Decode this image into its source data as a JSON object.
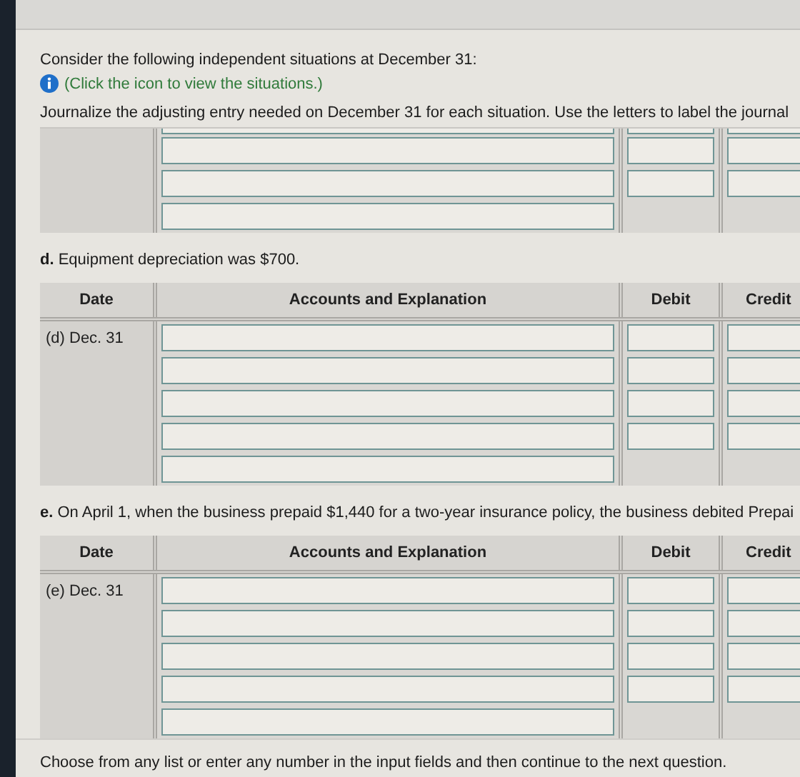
{
  "intro": {
    "heading": "Consider the following independent situations at December 31:",
    "info_link": "(Click the icon to view the situations.)",
    "instruction": "Journalize the adjusting entry needed on December 31 for each situation. Use the letters to label the journal"
  },
  "partial_table": {
    "rows": [
      {
        "amounts": true,
        "cut": true
      },
      {
        "amounts": true,
        "cut": false
      },
      {
        "amounts": true,
        "cut": false
      },
      {
        "amounts": false,
        "cut": false
      }
    ]
  },
  "entries": [
    {
      "prompt": "**d.** Equipment depreciation was $700.",
      "columns": [
        "Date",
        "Accounts and Explanation",
        "Debit",
        "Credit"
      ],
      "date": "(d) Dec. 31",
      "rows": [
        {
          "amounts": true
        },
        {
          "amounts": true
        },
        {
          "amounts": true
        },
        {
          "amounts": true
        },
        {
          "amounts": false
        }
      ]
    },
    {
      "prompt": "**e.** On April 1, when the business prepaid $1,440 for a two-year insurance policy, the business debited Prepai",
      "columns": [
        "Date",
        "Accounts and Explanation",
        "Debit",
        "Credit"
      ],
      "date": "(e) Dec. 31",
      "rows": [
        {
          "amounts": true
        },
        {
          "amounts": true
        },
        {
          "amounts": true
        },
        {
          "amounts": true
        },
        {
          "amounts": false
        }
      ]
    }
  ],
  "footer": "Choose from any list or enter any number in the input fields and then continue to the next question."
}
